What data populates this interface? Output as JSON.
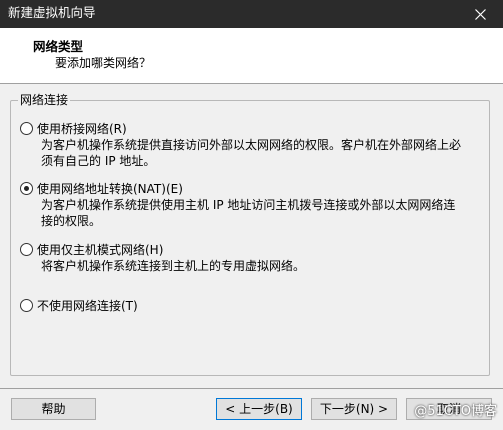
{
  "window": {
    "title": "新建虚拟机向导"
  },
  "header": {
    "title": "网络类型",
    "subtitle": "要添加哪类网络？"
  },
  "group": {
    "label": "网络连接"
  },
  "options": [
    {
      "label": "使用桥接网络(R)",
      "description": "为客户机操作系统提供直接访问外部以太网网络的权限。客户机在外部网络上必须有自己的 IP 地址。",
      "checked": false
    },
    {
      "label": "使用网络地址转换(NAT)(E)",
      "description": "为客户机操作系统提供使用主机 IP 地址访问主机拨号连接或外部以太网网络连接的权限。",
      "checked": true
    },
    {
      "label": "使用仅主机模式网络(H)",
      "description": "将客户机操作系统连接到主机上的专用虚拟网络。",
      "checked": false
    },
    {
      "label": "不使用网络连接(T)",
      "description": "",
      "checked": false
    }
  ],
  "buttons": {
    "help": "帮助",
    "back": "< 上一步(B)",
    "next": "下一步(N) >",
    "cancel": "取消"
  },
  "watermark": "@51CTO博客",
  "icons": {
    "close": "close-icon"
  }
}
